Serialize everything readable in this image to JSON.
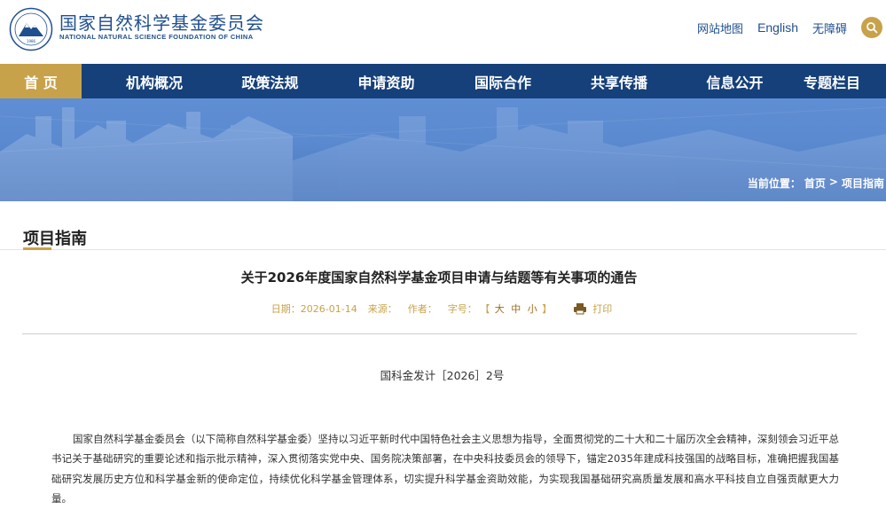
{
  "header": {
    "org_name_cn": "国家自然科学基金委员会",
    "org_name_en": "NATIONAL NATURAL SCIENCE FOUNDATION OF CHINA",
    "logo_year": "1986",
    "top_links": [
      "网站地图",
      "English",
      "无障碍"
    ],
    "search_icon": "search-icon"
  },
  "nav": {
    "items": [
      "首 页",
      "机构概况",
      "政策法规",
      "申请资助",
      "国际合作",
      "共享传播",
      "信息公开",
      "专题栏目"
    ],
    "active_index": 0
  },
  "breadcrumb": {
    "prefix": "当前位置：",
    "home": "首页",
    "separator": ">",
    "current": "项目指南"
  },
  "section": {
    "title": "项目指南"
  },
  "article": {
    "title": "关于2026年度国家自然科学基金项目申请与结题等有关事项的通告",
    "meta": {
      "date_label": "日期：",
      "date": "2026-01-14",
      "source_label": "来源：",
      "author_label": "作者：",
      "font_size_label": "字号：",
      "bracket_open": "【",
      "size_large": "大",
      "size_medium": "中",
      "size_small": "小",
      "bracket_close": "】",
      "print_label": "打印"
    },
    "doc_number": "国科金发计［2026］2号",
    "body": "国家自然科学基金委员会（以下简称自然科学基金委）坚持以习近平新时代中国特色社会主义思想为指导，全面贯彻党的二十大和二十届历次全会精神，深刻领会习近平总书记关于基础研究的重要论述和指示批示精神，深入贯彻落实党中央、国务院决策部署，在中央科技委员会的领导下，锚定2035年建成科技强国的战略目标，准确把握我国基础研究发展历史方位和科学基金新的使命定位，持续优化科学基金管理体系，切实提升科学基金资助效能，为实现我国基础研究高质量发展和高水平科技自立自强贡献更大力量。"
  },
  "colors": {
    "nav_bg": "#15407a",
    "accent_gold": "#c8a24a",
    "brand_blue": "#1f4f8f",
    "banner_blue": "#5b8ad0"
  }
}
